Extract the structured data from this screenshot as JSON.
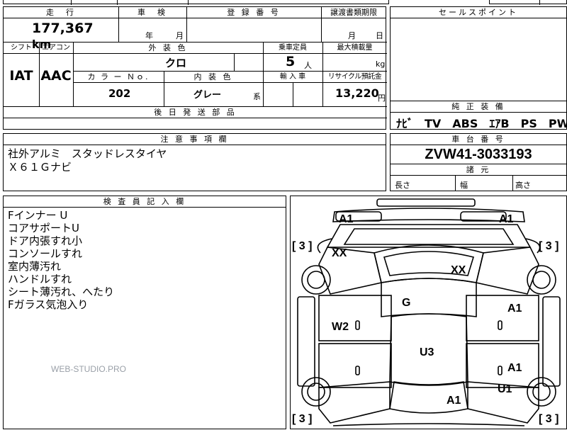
{
  "header": {
    "mileage_label": "走　行",
    "mileage_value": "177,367",
    "mileage_unit": "km",
    "inspection_label": "車　検",
    "inspection_year_unit": "年",
    "inspection_month_unit": "月",
    "registration_label": "登 録 番 号",
    "transfer_label": "譲渡書類期限",
    "transfer_month_unit": "月",
    "transfer_day_unit": "日",
    "sales_point_label": "セールスポイント"
  },
  "spec": {
    "shift_label": "シフト",
    "shift_value": "IAT",
    "aircon_label": "エアコン",
    "aircon_value": "AAC",
    "exterior_label": "外 装 色",
    "exterior_value": "クロ",
    "capacity_label": "乗車定員",
    "capacity_value": "5",
    "capacity_unit": "人",
    "load_label": "最大積載量",
    "load_unit": "kg",
    "color_no_label": "カ ラ ー Ｎｏ.",
    "color_no_value": "202",
    "interior_label": "内 装 色",
    "interior_value": "グレー",
    "interior_suffix": "系",
    "import_label": "輸 入 車",
    "recycle_label": "リサイクル預託金",
    "recycle_value": "13,220",
    "recycle_unit": "円",
    "later_parts_label": "後 日 発 送 部 品"
  },
  "equipment": {
    "label": "純 正 装 備",
    "value": "ﾅﾋﾞ　TV　ABS　ｴｱB　PS　PW"
  },
  "notes": {
    "label": "注 意 事 項 欄",
    "lines": [
      "社外アルミ　スタッドレスタイヤ",
      "Ｘ６１Ｇナビ"
    ]
  },
  "chassis": {
    "label": "車 台 番 号",
    "value": "ZVW41-3033193",
    "dims_label": "諸 元",
    "length_label": "長さ",
    "width_label": "幅",
    "height_label": "高さ"
  },
  "inspector": {
    "label": "検 査 員 記 入 欄",
    "lines": [
      "Fインナー U",
      "コアサポートU",
      "ドア内張すれ小",
      "コンソールすれ",
      "室内薄汚れ",
      "ハンドルすれ",
      "シート薄汚れ、へたり",
      "Fガラス気泡入り"
    ]
  },
  "diagram": {
    "marks": {
      "a1_tl": "A1",
      "a1_tr": "A1",
      "xx_l": "XX",
      "xx_r": "XX",
      "g": "G",
      "a1_rdoor": "A1",
      "w2": "W2",
      "u3": "U3",
      "a1_rdoor2": "A1",
      "u1": "U1",
      "a1_rear": "A1"
    },
    "brackets": {
      "tl": "[ 3 ]",
      "tr": "[ 3 ]",
      "bl": "[ 3 ]",
      "br": "[ 3 ]"
    }
  },
  "watermark": "WEB-STUDIO.PRO"
}
